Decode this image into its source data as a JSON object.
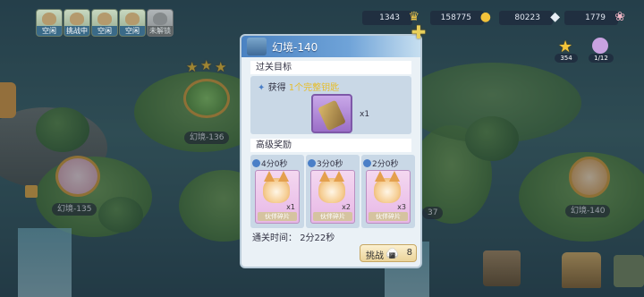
{
  "top_slots": [
    {
      "label": "空闲"
    },
    {
      "label": "挑战中"
    },
    {
      "label": "空闲"
    },
    {
      "label": "空闲"
    },
    {
      "label": "未解锁"
    }
  ],
  "resources": [
    {
      "value": "1343",
      "icon": "crown-icon"
    },
    {
      "value": "158775",
      "icon": "gold-icon"
    },
    {
      "value": "80223",
      "icon": "gem-icon"
    },
    {
      "value": "1779",
      "icon": "cat-icon"
    }
  ],
  "right_counters": {
    "star_count": "354",
    "key_count": "1/12"
  },
  "map": {
    "stage_136": "幻境-136",
    "stage_135": "幻境-135",
    "stage_137_partial": "37",
    "stage_140": "幻境-140"
  },
  "modal": {
    "title": "幻境-140",
    "goal_header": "过关目标",
    "goal_prefix": "获得",
    "goal_highlight": "1个完整钥匙",
    "goal_count": "x1",
    "reward_header": "高级奖励",
    "rewards": [
      {
        "time": "4分0秒",
        "count": "x1",
        "tag": "伙伴碎片"
      },
      {
        "time": "3分0秒",
        "count": "x2",
        "tag": "伙伴碎片"
      },
      {
        "time": "2分0秒",
        "count": "x3",
        "tag": "伙伴碎片"
      }
    ],
    "clear_time_label": "通关时间：",
    "clear_time": "2分22秒",
    "challenge_label": "挑战",
    "challenge_cost": "8"
  }
}
